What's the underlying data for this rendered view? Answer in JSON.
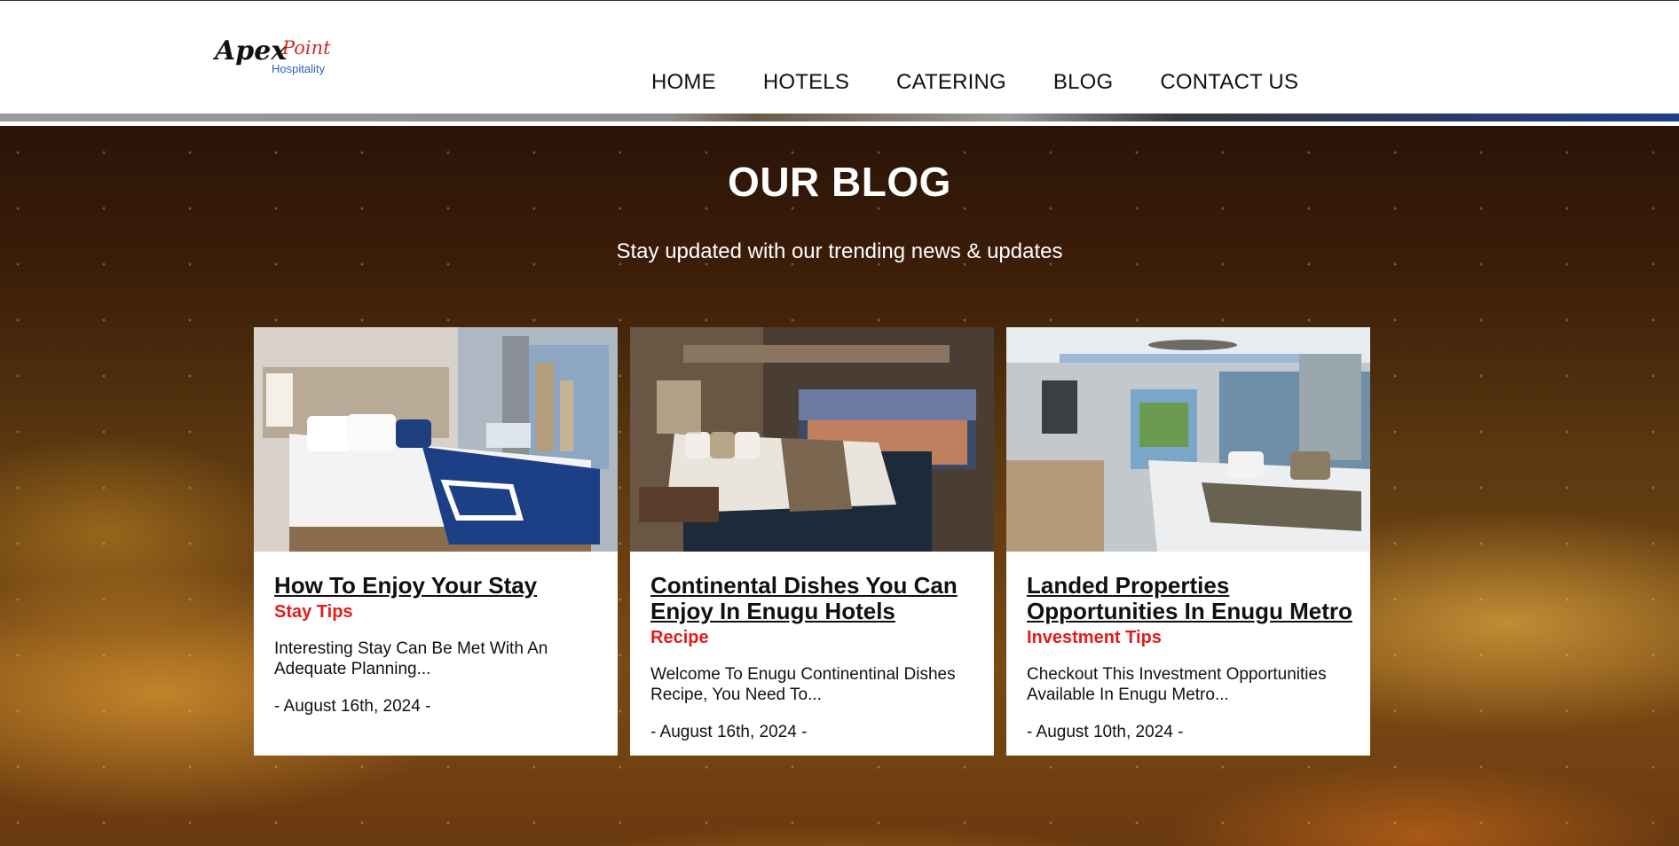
{
  "brand": {
    "logo_word1": "Apex",
    "logo_word2": "Point",
    "logo_sub": "Hospitality"
  },
  "nav": {
    "items": [
      {
        "label": "HOME"
      },
      {
        "label": "HOTELS"
      },
      {
        "label": "CATERING"
      },
      {
        "label": "BLOG"
      },
      {
        "label": "CONTACT US"
      }
    ]
  },
  "hero": {
    "title": "OUR BLOG",
    "subtitle": "Stay updated with our trending news & updates"
  },
  "posts": [
    {
      "title": "How To Enjoy Your Stay",
      "category": "Stay Tips",
      "excerpt": "Interesting Stay Can Be Met With An Adequate Planning...",
      "date": "- August 16th, 2024 -"
    },
    {
      "title": "Continental Dishes You Can Enjoy In Enugu Hotels",
      "category": "Recipe",
      "excerpt": "Welcome To Enugu Continentinal Dishes Recipe, You Need To...",
      "date": "- August 16th, 2024 -"
    },
    {
      "title": "Landed Properties Opportunities In Enugu Metro",
      "category": "Investment Tips",
      "excerpt": "Checkout This Investment Opportunities Available In Enugu Metro...",
      "date": "- August 10th, 2024 -"
    }
  ],
  "colors": {
    "category_red": "#e31b1b",
    "logo_red": "#d22a2a",
    "logo_blue": "#2a63b8"
  }
}
